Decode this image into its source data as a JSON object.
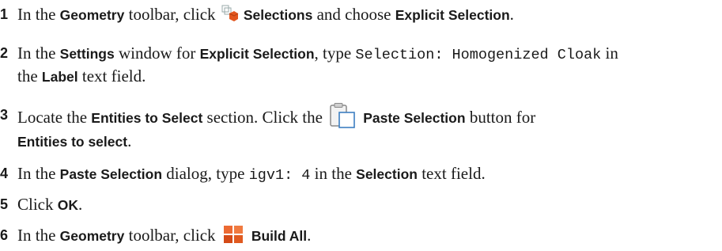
{
  "steps": [
    {
      "num": "1",
      "a": "In the ",
      "b1": "Geometry",
      "c": " toolbar, click ",
      "icon": "selections-icon",
      "b2": "Selections",
      "d": " and choose ",
      "b3": "Explicit Selection",
      "e": "."
    },
    {
      "num": "2",
      "a": "In the ",
      "b1": "Settings",
      "c": " window for ",
      "b2": "Explicit Selection",
      "d": ", type ",
      "m1": "Selection: Homogenized Cloak",
      "e": " in",
      "l2a": "the ",
      "b3": "Label",
      "l2b": " text field."
    },
    {
      "num": "3",
      "a": "Locate the ",
      "b1": "Entities to Select",
      "c": " section. Click the ",
      "icon": "paste-selection-icon",
      "b2": "Paste Selection",
      "d": " button for",
      "b3": "Entities to select",
      "e": "."
    },
    {
      "num": "4",
      "a": "In the ",
      "b1": "Paste Selection",
      "c": " dialog, type ",
      "m1": "igv1: 4",
      "d": " in the ",
      "b2": "Selection",
      "e": " text field."
    },
    {
      "num": "5",
      "a": "Click ",
      "b1": "OK",
      "c": "."
    },
    {
      "num": "6",
      "a": "In the ",
      "b1": "Geometry",
      "c": " toolbar, click ",
      "icon": "build-all-icon",
      "b2": "Build All",
      "d": "."
    }
  ]
}
